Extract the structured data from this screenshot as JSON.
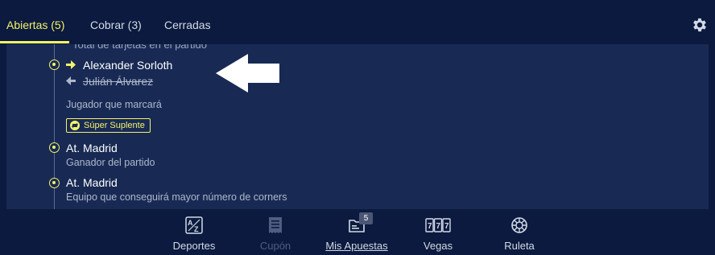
{
  "tabs": [
    {
      "label": "Abiertas (5)",
      "active": true
    },
    {
      "label": "Cobrar (3)",
      "active": false
    },
    {
      "label": "Cerradas",
      "active": false
    }
  ],
  "colors": {
    "accent": "#f4f269",
    "background": "#0b1a3e",
    "panel": "#182a54"
  },
  "bets": {
    "cut_text": "Total de tarjetas en el partido",
    "substitution": {
      "player_in": "Alexander Sorloth",
      "player_out": "Julián Álvarez",
      "market": "Jugador que marcará",
      "badge": "Súper Suplente"
    },
    "item2": {
      "selection": "At. Madrid",
      "market": "Ganador del partido"
    },
    "item3": {
      "selection": "At. Madrid",
      "market": "Equipo que conseguirá mayor número de corners"
    }
  },
  "bottom_nav": [
    {
      "label": "Deportes",
      "icon": "az-icon"
    },
    {
      "label": "Cupón",
      "icon": "receipt-icon",
      "disabled": true
    },
    {
      "label": "Mis Apuestas",
      "icon": "folder-icon",
      "badge": "5",
      "active": true
    },
    {
      "label": "Vegas",
      "icon": "slots-icon"
    },
    {
      "label": "Ruleta",
      "icon": "roulette-icon"
    }
  ]
}
